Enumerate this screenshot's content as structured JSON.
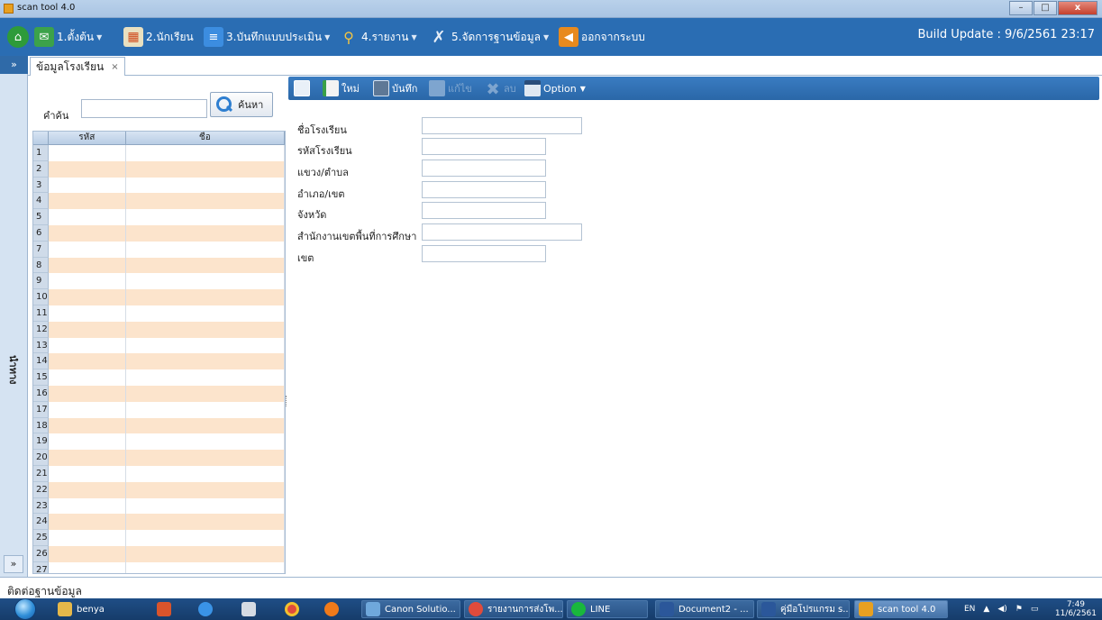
{
  "window": {
    "title": "scan tool 4.0",
    "buttons": {
      "minimize": "–",
      "maximize": "□",
      "close": "x"
    }
  },
  "menubar": {
    "items": [
      {
        "label": "1.ตั้งต้น",
        "icon": "envelope-icon",
        "dropdown": true
      },
      {
        "label": "2.นักเรียน",
        "icon": "grid-icon",
        "dropdown": false
      },
      {
        "label": "3.บันทึกแบบประเมิน",
        "icon": "document-icon",
        "dropdown": true
      },
      {
        "label": "4.รายงาน",
        "icon": "report-search-icon",
        "dropdown": true
      },
      {
        "label": "5.จัดการฐานข้อมูล",
        "icon": "tools-icon",
        "dropdown": true
      },
      {
        "label": "ออกจากระบบ",
        "icon": "exit-icon",
        "dropdown": false
      }
    ],
    "build": "Build Update : 9/6/2561  23:17"
  },
  "sidebar": {
    "expand_top": "»",
    "vertical_label": "นำทาง",
    "expand_bottom": "»"
  },
  "tabs": [
    {
      "label": "ข้อมูลโรงเรียน",
      "close": "×"
    }
  ],
  "search": {
    "label": "คำค้น",
    "value": "",
    "button_label": "ค้นหา"
  },
  "grid": {
    "columns": [
      "รหัส",
      "ชื่อ"
    ],
    "rows": [
      "1",
      "2",
      "3",
      "4",
      "5",
      "6",
      "7",
      "8",
      "9",
      "10",
      "11",
      "12",
      "13",
      "14",
      "15",
      "16",
      "17",
      "18",
      "19",
      "20",
      "21",
      "22",
      "23",
      "24",
      "25",
      "26",
      "27"
    ]
  },
  "toolbar": {
    "new_label": "ใหม่",
    "save_label": "บันทึก",
    "disabled1_label": "แก้ไข",
    "disabled2_label": "ลบ",
    "option_label": "Option"
  },
  "form": {
    "fields": [
      {
        "label": "ชื่อโรงเรียน",
        "value": ""
      },
      {
        "label": "รหัสโรงเรียน",
        "value": ""
      },
      {
        "label": "แขวง/ตำบล",
        "value": ""
      },
      {
        "label": "อำเภอ/เขต",
        "value": ""
      },
      {
        "label": "จังหวัด",
        "value": ""
      },
      {
        "label": "สำนักงานเขตพื้นที่การศึกษา",
        "value": ""
      },
      {
        "label": "เขต",
        "value": ""
      }
    ]
  },
  "status": {
    "text": "ติดต่อฐานข้อมูล"
  },
  "taskbar": {
    "pinned": [
      {
        "label": "benya",
        "icon": "folder-icon"
      },
      {
        "label": "",
        "icon": "media-player-icon"
      },
      {
        "label": "",
        "icon": "internet-explorer-icon"
      },
      {
        "label": "",
        "icon": "calculator-icon"
      },
      {
        "label": "",
        "icon": "chrome-icon"
      },
      {
        "label": "",
        "icon": "firefox-icon"
      }
    ],
    "tasks": [
      {
        "label": "Canon Solutio...",
        "icon": "canon-icon"
      },
      {
        "label": "รายงานการส่งโพ...",
        "icon": "chrome-icon"
      },
      {
        "label": "LINE",
        "icon": "line-icon"
      },
      {
        "label": "Document2 - ...",
        "icon": "word-icon"
      },
      {
        "label": "คู่มือโปรแกรม s...",
        "icon": "word-icon"
      },
      {
        "label": "scan tool 4.0",
        "icon": "scan-tool-icon"
      }
    ],
    "tray": {
      "lang": "EN",
      "time": "7:49",
      "date": "11/6/2561"
    }
  },
  "colors": {
    "menubar": "#2a6db3",
    "row_alt": "#fce4cc",
    "taskbar": "#1f4e86"
  }
}
